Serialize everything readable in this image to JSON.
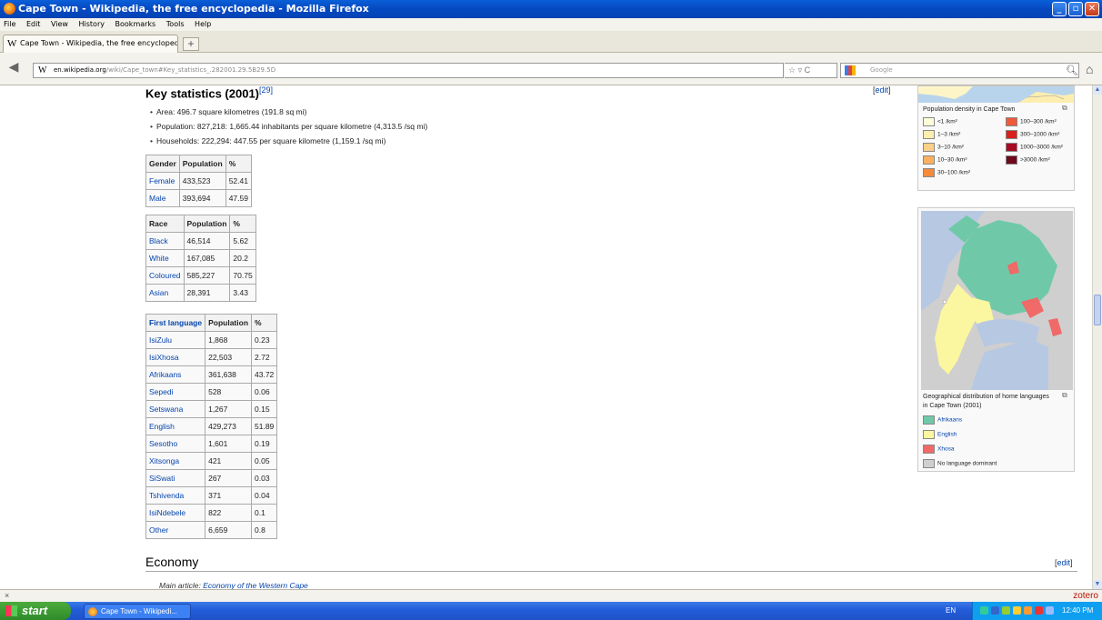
{
  "window": {
    "title": "Cape Town - Wikipedia, the free encyclopedia - Mozilla Firefox"
  },
  "menu": [
    "File",
    "Edit",
    "View",
    "History",
    "Bookmarks",
    "Tools",
    "Help"
  ],
  "tab": {
    "title": "Cape Town - Wikipedia, the free encyclopedia",
    "new_tab": "+"
  },
  "url": {
    "domain": "en.wikipedia.org",
    "path": "/wiki/Cape_town#Key_statistics_.282001.29.5B29.5D"
  },
  "search": {
    "placeholder": "Google"
  },
  "section": {
    "title": "Key statistics (2001)",
    "ref": "[29]",
    "edit": "edit",
    "bullets": [
      "Area: 496.7 square kilometres (191.8 sq mi)",
      "Population: 827,218: 1,665.44 inhabitants per square kilometre (4,313.5 /sq mi)",
      "Households: 222,294: 447.55 per square kilometre (1,159.1 /sq mi)"
    ]
  },
  "gender_table": {
    "headers": [
      "Gender",
      "Population",
      "%"
    ],
    "rows": [
      [
        "Female",
        "433,523",
        "52.41"
      ],
      [
        "Male",
        "393,694",
        "47.59"
      ]
    ]
  },
  "race_table": {
    "headers": [
      "Race",
      "Population",
      "%"
    ],
    "rows": [
      [
        "Black",
        "46,514",
        "5.62"
      ],
      [
        "White",
        "167,085",
        "20.2"
      ],
      [
        "Coloured",
        "585,227",
        "70.75"
      ],
      [
        "Asian",
        "28,391",
        "3.43"
      ]
    ]
  },
  "language_table": {
    "headers": [
      "First language",
      "Population",
      "%"
    ],
    "rows": [
      [
        "IsiZulu",
        "1,868",
        "0.23"
      ],
      [
        "IsiXhosa",
        "22,503",
        "2.72"
      ],
      [
        "Afrikaans",
        "361,638",
        "43.72"
      ],
      [
        "Sepedi",
        "528",
        "0.06"
      ],
      [
        "Setswana",
        "1,267",
        "0.15"
      ],
      [
        "English",
        "429,273",
        "51.89"
      ],
      [
        "Sesotho",
        "1,601",
        "0.19"
      ],
      [
        "Xitsonga",
        "421",
        "0.05"
      ],
      [
        "SiSwati",
        "267",
        "0.03"
      ],
      [
        "Tshivenda",
        "371",
        "0.04"
      ],
      [
        "IsiNdebele",
        "822",
        "0.1"
      ],
      [
        "Other",
        "6,659",
        "0.8"
      ]
    ]
  },
  "density_legend": {
    "title": "Population density in Cape Town",
    "items": [
      {
        "label": "<1 /km²",
        "color": "#fefdd8"
      },
      {
        "label": "1–3 /km²",
        "color": "#fdeeb0"
      },
      {
        "label": "3–10 /km²",
        "color": "#fdd08a"
      },
      {
        "label": "10–30 /km²",
        "color": "#fbb060"
      },
      {
        "label": "30–100 /km²",
        "color": "#f58a3a"
      },
      {
        "label": "100–300 /km²",
        "color": "#ef5a3a"
      },
      {
        "label": "300–1000 /km²",
        "color": "#d8201c"
      },
      {
        "label": "1000–3000 /km²",
        "color": "#a80b22"
      },
      {
        "label": ">3000 /km²",
        "color": "#6e0a1c"
      }
    ]
  },
  "language_map": {
    "caption": "Geographical distribution of home languages in Cape Town (2001)",
    "items": [
      {
        "label": "Afrikaans",
        "color": "#6fc9a8"
      },
      {
        "label": "English",
        "color": "#fbf6a0"
      },
      {
        "label": "Xhosa",
        "color": "#ef6a68"
      },
      {
        "label": "No language dominant",
        "color": "#cfcfcf"
      }
    ]
  },
  "economy": {
    "title": "Economy",
    "edit": "edit",
    "main_prefix": "Main article: ",
    "main_link": "Economy of the Western Cape"
  },
  "status": {
    "close": "×",
    "zotero": "zotero"
  },
  "taskbar": {
    "start": "start",
    "item": "Cape Town - Wikipedi...",
    "lang": "EN",
    "time": "12:40 PM"
  }
}
